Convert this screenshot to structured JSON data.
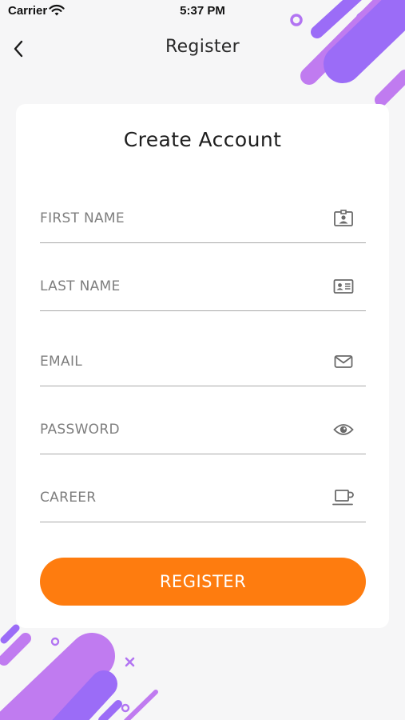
{
  "status_bar": {
    "carrier": "Carrier",
    "time": "5:37 PM"
  },
  "nav": {
    "title": "Register"
  },
  "form": {
    "heading": "Create Account",
    "fields": [
      {
        "placeholder": "FIRST NAME",
        "value": "",
        "icon": "contact-badge-icon"
      },
      {
        "placeholder": "LAST NAME",
        "value": "",
        "icon": "id-card-icon"
      },
      {
        "placeholder": "EMAIL",
        "value": "",
        "icon": "envelope-icon"
      },
      {
        "placeholder": "PASSWORD",
        "value": "",
        "icon": "eye-icon"
      },
      {
        "placeholder": "CAREER",
        "value": "",
        "icon": "coffee-cup-icon"
      }
    ],
    "submit_label": "REGISTER"
  },
  "colors": {
    "accent": "#fe7c0f",
    "decor_purple": "#9b6cf7",
    "decor_violet": "#c07bf0",
    "background": "#f6f6f7"
  }
}
